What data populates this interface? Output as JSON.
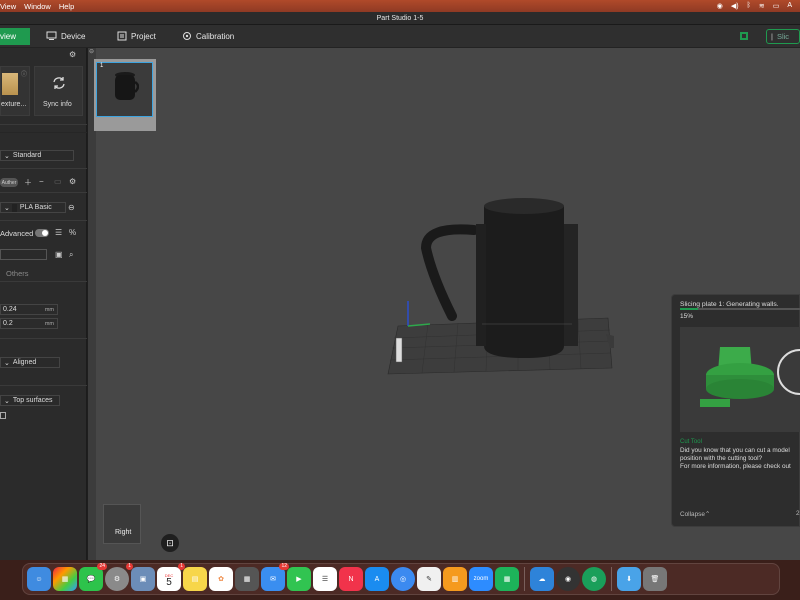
{
  "menubar": {
    "items": [
      "View",
      "Window",
      "Help"
    ]
  },
  "window": {
    "title": "Part Studio 1-5"
  },
  "tabs": {
    "preview": "view",
    "device": "Device",
    "project": "Project",
    "calibration": "Calibration",
    "slice": "Slic"
  },
  "left_panel": {
    "plate_texture": "exture...",
    "sync_info": "Sync info",
    "process_preset": "Standard",
    "nozzle_tag": "Auther",
    "filament": "PLA Basic",
    "advanced_label": "Advanced",
    "others_tab": "Others",
    "layer_height": "0.24",
    "layer_height_unit": "mm",
    "initial_layer": "0.2",
    "initial_layer_unit": "mm",
    "seam": "Aligned",
    "ironing": "Top surfaces"
  },
  "viewport": {
    "plate_number": "1",
    "view_cube_label": "Right"
  },
  "popup": {
    "status": "Slicing plate 1: Generating walls.",
    "percent": "15%",
    "progress_fraction": 0.15,
    "tip_title": "Cut Tool",
    "tip_line1": "Did you know that you can cut a model",
    "tip_line2": "position with the cutting tool?",
    "tip_line3": "For more information, please check out",
    "collapse": "Collapse",
    "page": "2"
  },
  "dock": {
    "messages_badge": "24",
    "settings_badge": "1",
    "calendar_month": "DEC",
    "calendar_day": "5",
    "calendar_badge": "1",
    "mail_badge": "12",
    "zoom_label": "zoom"
  },
  "colors": {
    "accent": "#1f9a4f",
    "viewport_bg": "#474747"
  }
}
